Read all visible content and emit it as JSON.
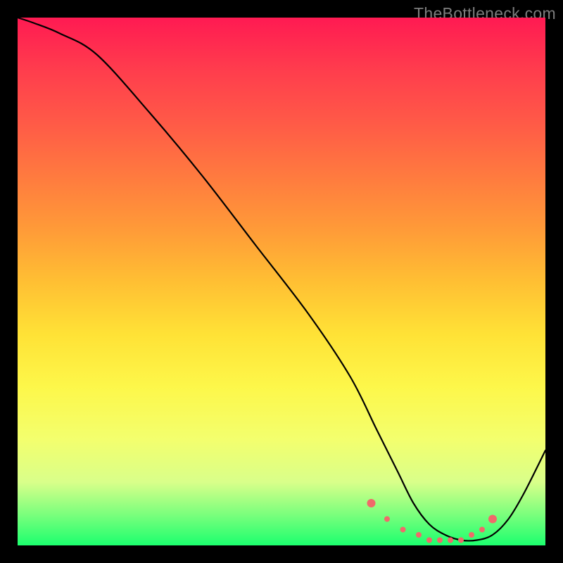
{
  "watermark": "TheBottleneck.com",
  "chart_data": {
    "type": "line",
    "title": "",
    "xlabel": "",
    "ylabel": "",
    "xlim": [
      0,
      100
    ],
    "ylim": [
      0,
      100
    ],
    "grid": false,
    "legend": false,
    "series": [
      {
        "name": "bottleneck-curve",
        "x": [
          0,
          3,
          8,
          15,
          25,
          35,
          45,
          55,
          63,
          68,
          72,
          75,
          78,
          81,
          84,
          87,
          90,
          93,
          96,
          100
        ],
        "y": [
          100,
          99,
          97,
          93,
          82,
          70,
          57,
          44,
          32,
          22,
          14,
          8,
          4,
          2,
          1,
          1,
          2,
          5,
          10,
          18
        ]
      }
    ],
    "highlight_points": {
      "name": "optimal-range-dots",
      "color": "#f06a6a",
      "x": [
        67,
        70,
        73,
        76,
        78,
        80,
        82,
        84,
        86,
        88,
        90
      ],
      "y": [
        8,
        5,
        3,
        2,
        1,
        1,
        1,
        1,
        2,
        3,
        5
      ]
    },
    "background_gradient": {
      "top_color": "#ff1a52",
      "mid_color": "#fff23a",
      "bottom_color": "#1cff6e"
    }
  }
}
